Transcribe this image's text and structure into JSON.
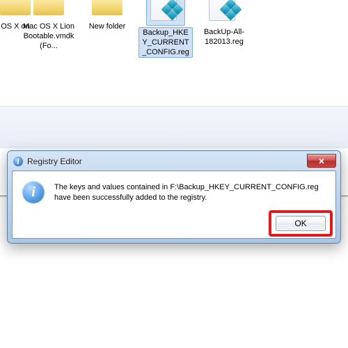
{
  "explorer": {
    "files": [
      {
        "name": "OS X\n on",
        "kind": "folder"
      },
      {
        "name": "Mac OS X Lion Bootable.vmdk (Fo...",
        "kind": "folder"
      },
      {
        "name": "New folder",
        "kind": "folder"
      },
      {
        "name": "Backup_HKEY_CURRENT_CONFIG.reg",
        "kind": "reg",
        "selected": true
      },
      {
        "name": "BackUp-All-182013.reg",
        "kind": "reg"
      }
    ]
  },
  "dialog": {
    "title": "Registry Editor",
    "icon_name": "info-icon",
    "message": "The keys and values contained in F:\\Backup_HKEY_CURRENT_CONFIG.reg have been successfully added to the registry.",
    "ok_label": "OK",
    "close_label": "✕"
  },
  "highlight": {
    "target": "ok-button"
  }
}
